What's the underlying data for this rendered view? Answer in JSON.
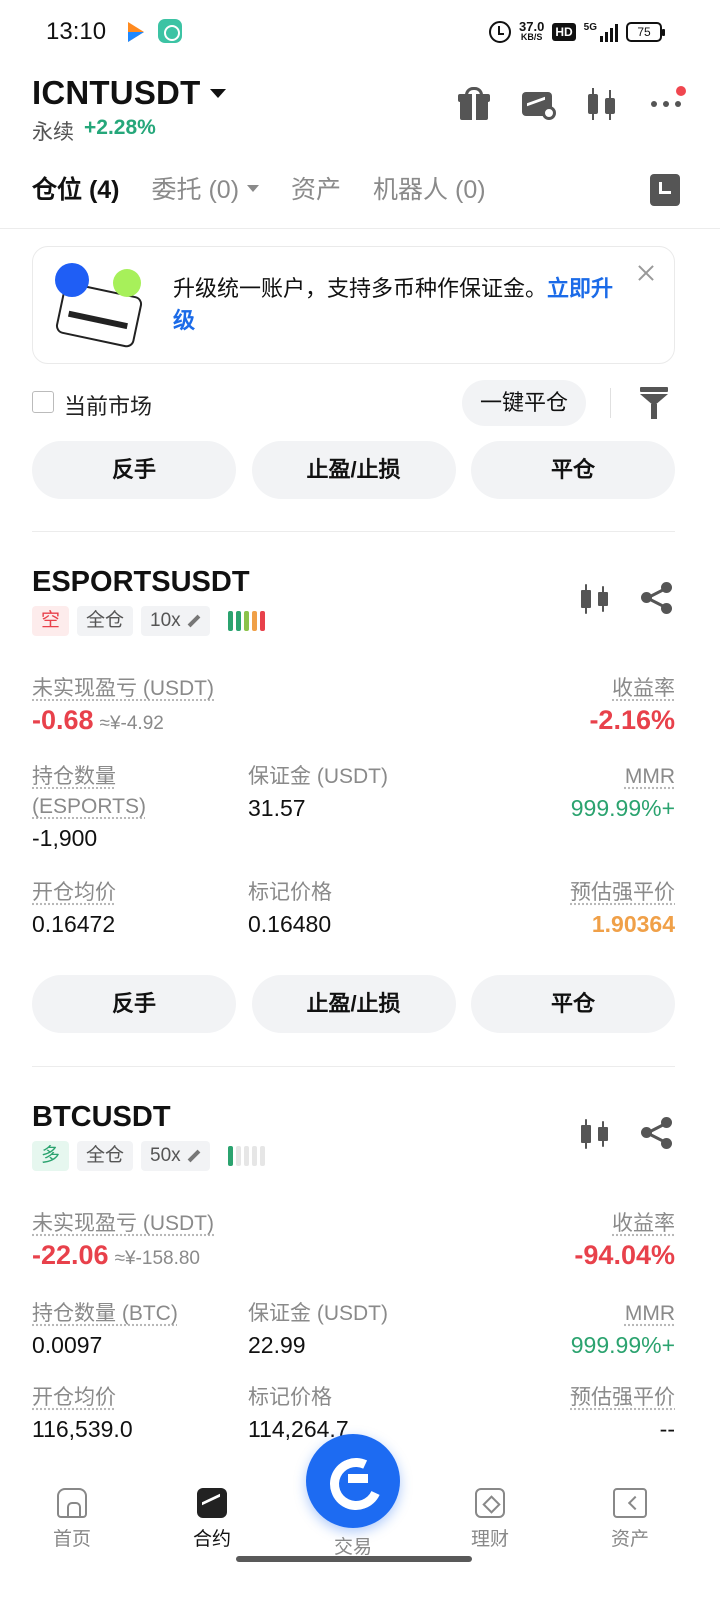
{
  "status_bar": {
    "time": "13:10",
    "net_speed": "37.0",
    "net_unit": "KB/S",
    "hd": "HD",
    "signal": "5G",
    "battery": "75"
  },
  "header": {
    "symbol": "ICNTUSDT",
    "contract_type": "永续",
    "change": "+2.28%"
  },
  "tabs": [
    {
      "label": "仓位 (4)"
    },
    {
      "label": "委托 (0)"
    },
    {
      "label": "资产"
    },
    {
      "label": "机器人 (0)"
    }
  ],
  "banner": {
    "text": "升级统一账户，支持多币种作保证金。",
    "link": "立即升级"
  },
  "filter": {
    "current_market": "当前市场",
    "close_all": "一键平仓"
  },
  "actions": {
    "reverse": "反手",
    "tpsl": "止盈/止损",
    "close": "平仓"
  },
  "positions": [
    {
      "symbol": "ESPORTSUSDT",
      "side": "空",
      "margin_mode": "全仓",
      "leverage": "10x",
      "adl_level": 5,
      "pnl_label": "未实现盈亏 (USDT)",
      "pnl": "-0.68",
      "pnl_cny": "≈¥-4.92",
      "roe_label": "收益率",
      "roe": "-2.16%",
      "size_label": "持仓数量 (ESPORTS)",
      "size": "-1,900",
      "margin_label": "保证金 (USDT)",
      "margin": "31.57",
      "mmr_label": "MMR",
      "mmr": "999.99%+",
      "entry_label": "开仓均价",
      "entry": "0.16472",
      "mark_label": "标记价格",
      "mark": "0.16480",
      "liq_label": "预估强平价",
      "liq": "1.90364"
    },
    {
      "symbol": "BTCUSDT",
      "side": "多",
      "margin_mode": "全仓",
      "leverage": "50x",
      "adl_level": 1,
      "pnl_label": "未实现盈亏 (USDT)",
      "pnl": "-22.06",
      "pnl_cny": "≈¥-158.80",
      "roe_label": "收益率",
      "roe": "-94.04%",
      "size_label": "持仓数量 (BTC)",
      "size": "0.0097",
      "margin_label": "保证金 (USDT)",
      "margin": "22.99",
      "mmr_label": "MMR",
      "mmr": "999.99%+",
      "entry_label": "开仓均价",
      "entry": "116,539.0",
      "mark_label": "标记价格",
      "mark": "114,264.7",
      "liq_label": "预估强平价",
      "liq": "--"
    }
  ],
  "bottom_nav": [
    {
      "label": "首页",
      "icon": "home-icon"
    },
    {
      "label": "合约",
      "icon": "futures-icon"
    },
    {
      "label": "交易",
      "icon": "trade-icon"
    },
    {
      "label": "理财",
      "icon": "wealth-icon"
    },
    {
      "label": "资产",
      "icon": "assets-icon"
    }
  ],
  "colors": {
    "accent": "#1d6bf2",
    "up": "#2ba36f",
    "down": "#e8414b",
    "warning": "#f0a048"
  }
}
